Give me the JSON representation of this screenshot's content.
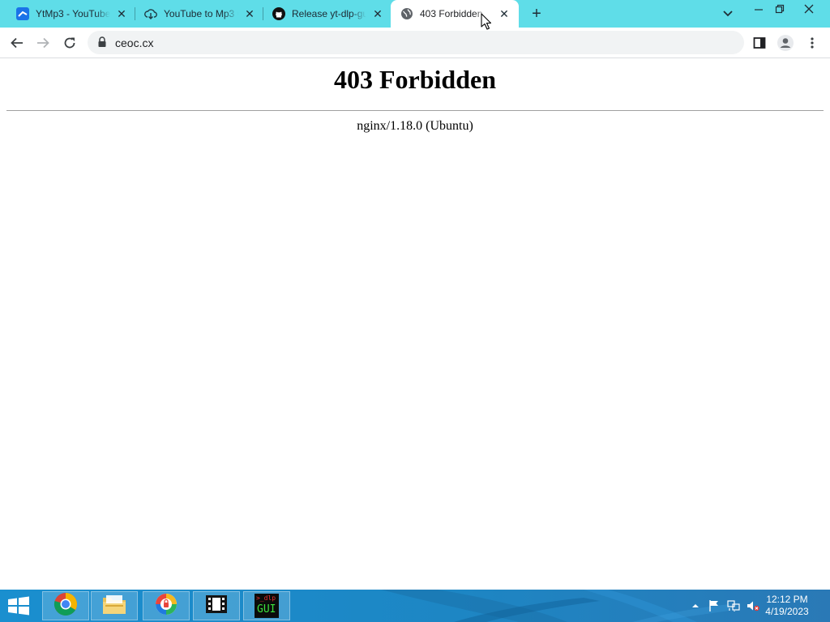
{
  "tabs": [
    {
      "title": "YtMp3 - YouTube",
      "icon": "ytmp3-icon"
    },
    {
      "title": "YouTube to Mp3 C",
      "icon": "cloud-download-icon"
    },
    {
      "title": "Release yt-dlp-gui",
      "icon": "github-icon"
    },
    {
      "title": "403 Forbidden",
      "icon": "globe-icon"
    }
  ],
  "toolbar": {
    "url": "ceoc.cx"
  },
  "page": {
    "heading": "403 Forbidden",
    "server": "nginx/1.18.0 (Ubuntu)"
  },
  "taskbar": {
    "apps": [
      "chrome-icon",
      "file-explorer-icon",
      "vpn-icon",
      "media-player-icon",
      "yt-dlp-gui-icon"
    ],
    "labels": {
      "ytdlp_top": ">_dlp",
      "ytdlp_bottom": "GUI"
    },
    "time": "12:12 PM",
    "date": "4/19/2023"
  },
  "colors": {
    "tabstrip": "#5fdde8",
    "taskbar": "#1d86c4"
  }
}
